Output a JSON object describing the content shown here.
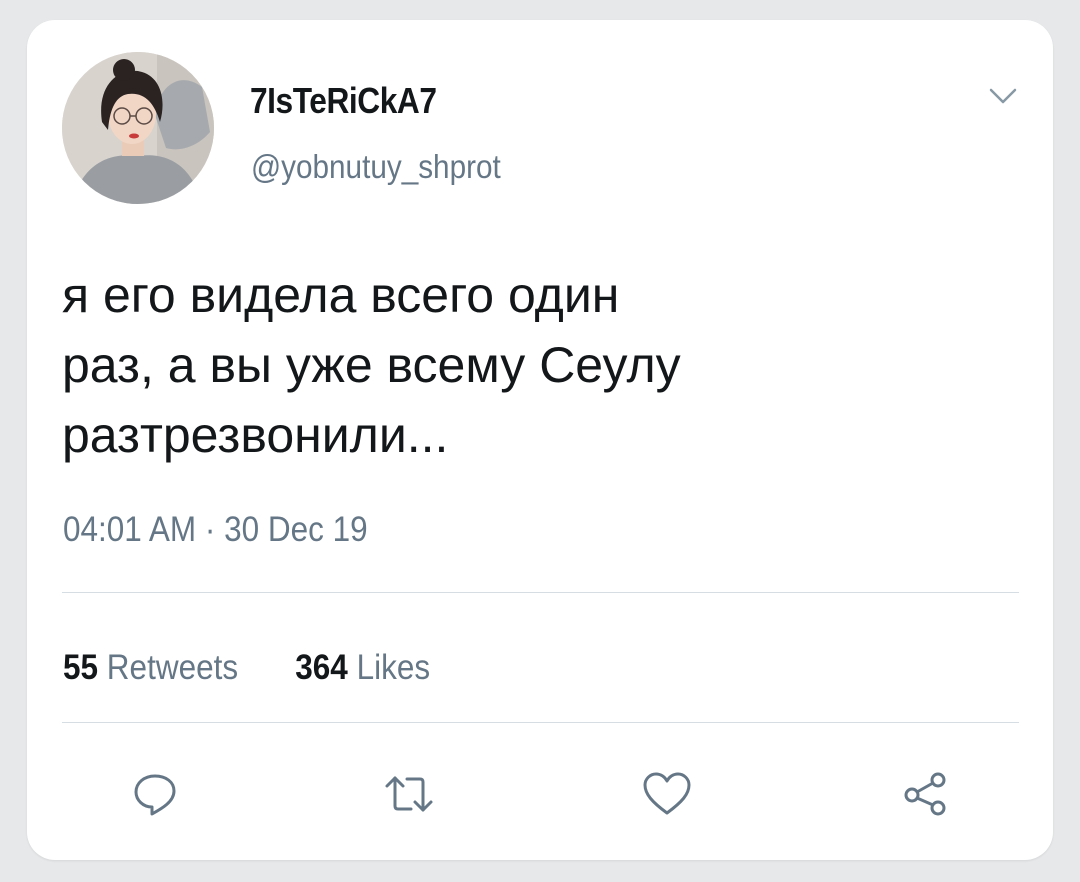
{
  "tweet": {
    "display_name": "7IsTeRiCkA7",
    "handle": "@yobnutuy_shprot",
    "text": "я его видела всего один\nраз, а вы уже всему Сеулу\nразтрезвонили...",
    "timestamp": "04:01 AM · 30 Dec 19"
  },
  "stats": {
    "retweets_count": "55",
    "retweets_label": "Retweets",
    "likes_count": "364",
    "likes_label": "Likes"
  },
  "icons": {
    "menu": "chevron-down-icon",
    "reply": "reply-icon",
    "retweet": "retweet-icon",
    "like": "heart-icon",
    "share": "share-icon"
  },
  "colors": {
    "text_primary": "#14171a",
    "text_secondary": "#657786",
    "icon": "#657786",
    "divider": "#d6dde3",
    "background": "#e6e8ea",
    "card": "#ffffff"
  }
}
